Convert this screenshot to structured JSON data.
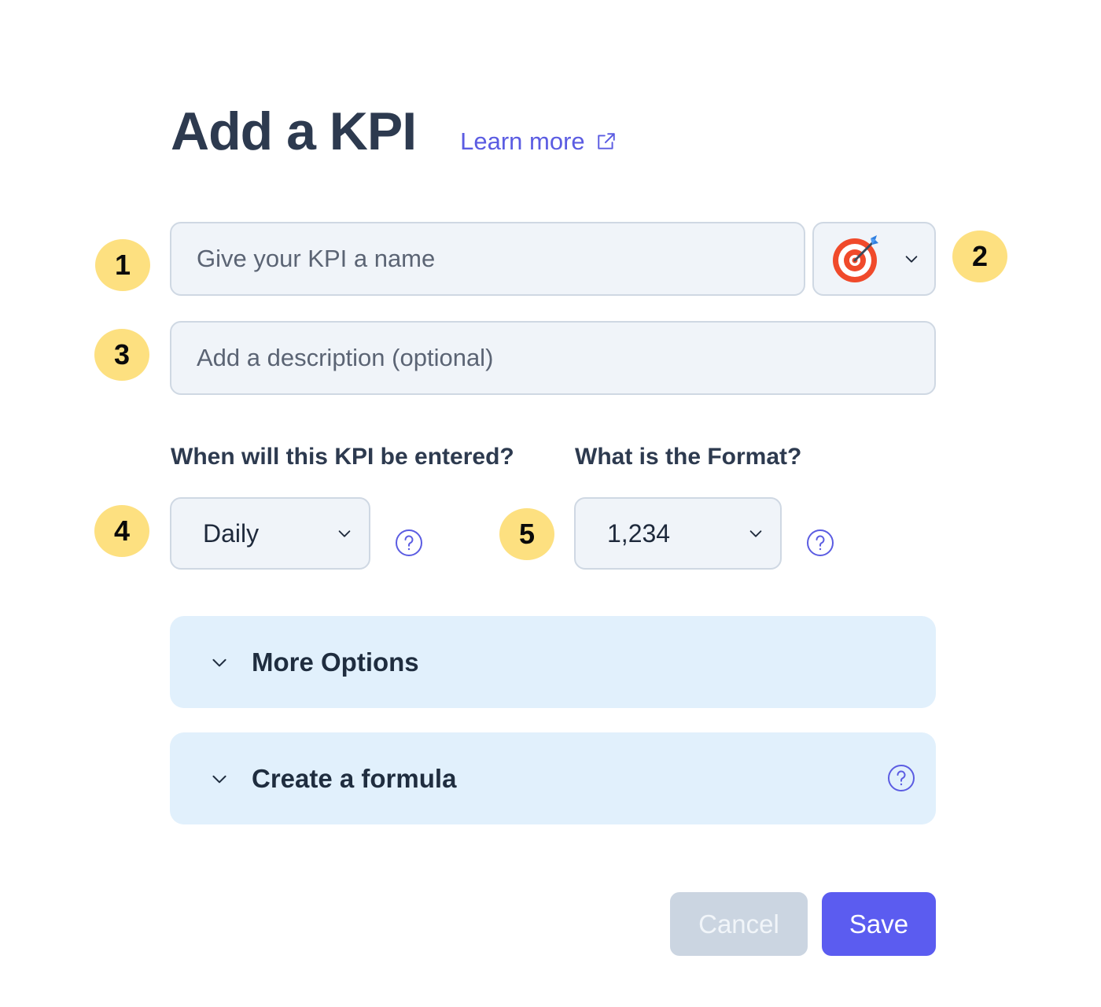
{
  "header": {
    "title": "Add a KPI",
    "learn_more": "Learn more",
    "learn_more_icon": "external-link-icon"
  },
  "badges": [
    "1",
    "2",
    "3",
    "4",
    "5"
  ],
  "name_field": {
    "placeholder": "Give your KPI a name",
    "value": ""
  },
  "icon_picker": {
    "selected_icon": "target-bullseye-icon"
  },
  "description_field": {
    "placeholder": "Add a description (optional)",
    "value": ""
  },
  "frequency": {
    "label": "When will this KPI be entered?",
    "value": "Daily"
  },
  "format": {
    "label": "What is the Format?",
    "value": "1,234"
  },
  "sections": [
    {
      "label": "More Options",
      "has_help": false
    },
    {
      "label": "Create a formula",
      "has_help": true
    }
  ],
  "buttons": {
    "cancel": "Cancel",
    "save": "Save"
  },
  "colors": {
    "accent": "#5b5cf0",
    "badge": "#fde080",
    "accordion_bg": "#e1f0fc",
    "field_bg": "#f0f4f9"
  }
}
